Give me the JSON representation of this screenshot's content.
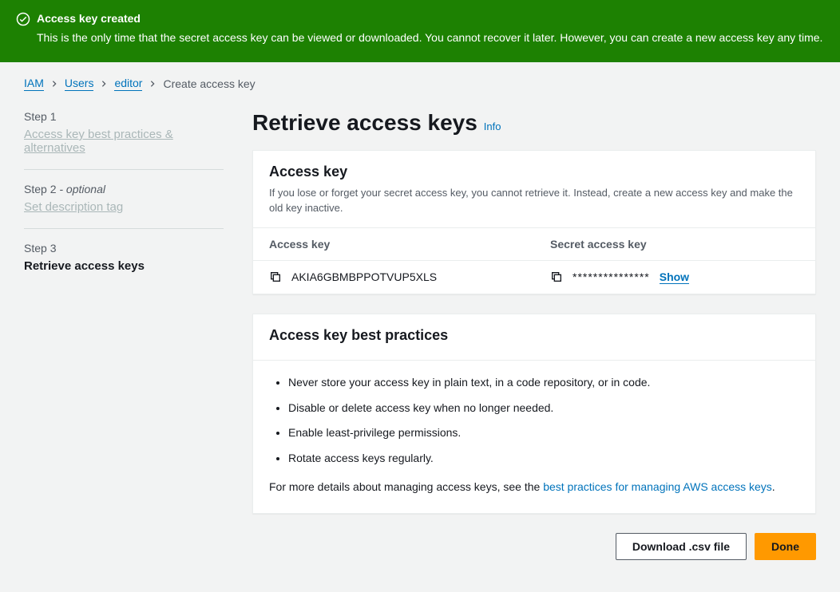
{
  "banner": {
    "title": "Access key created",
    "body": "This is the only time that the secret access key can be viewed or downloaded. You cannot recover it later. However, you can create a new access key any time."
  },
  "breadcrumbs": {
    "items": [
      "IAM",
      "Users",
      "editor"
    ],
    "current": "Create access key"
  },
  "sidebar": {
    "steps": [
      {
        "label": "Step 1",
        "optional": "",
        "title": "Access key best practices & alternatives",
        "current": false
      },
      {
        "label": "Step 2",
        "optional": " - optional",
        "title": "Set description tag",
        "current": false
      },
      {
        "label": "Step 3",
        "optional": "",
        "title": "Retrieve access keys",
        "current": true
      }
    ]
  },
  "page": {
    "title": "Retrieve access keys",
    "info": "Info"
  },
  "access_key_panel": {
    "title": "Access key",
    "desc": "If you lose or forget your secret access key, you cannot retrieve it. Instead, create a new access key and make the old key inactive.",
    "col1": "Access key",
    "col2": "Secret access key",
    "access_key": "AKIA6GBMBPPOTVUP5XLS",
    "secret_masked": "***************",
    "show": "Show"
  },
  "best_practices": {
    "title": "Access key best practices",
    "items": [
      "Never store your access key in plain text, in a code repository, or in code.",
      "Disable or delete access key when no longer needed.",
      "Enable least-privilege permissions.",
      "Rotate access keys regularly."
    ],
    "more_pre": "For more details about managing access keys, see the ",
    "more_link": "best practices for managing AWS access keys",
    "more_post": "."
  },
  "actions": {
    "download": "Download .csv file",
    "done": "Done"
  }
}
